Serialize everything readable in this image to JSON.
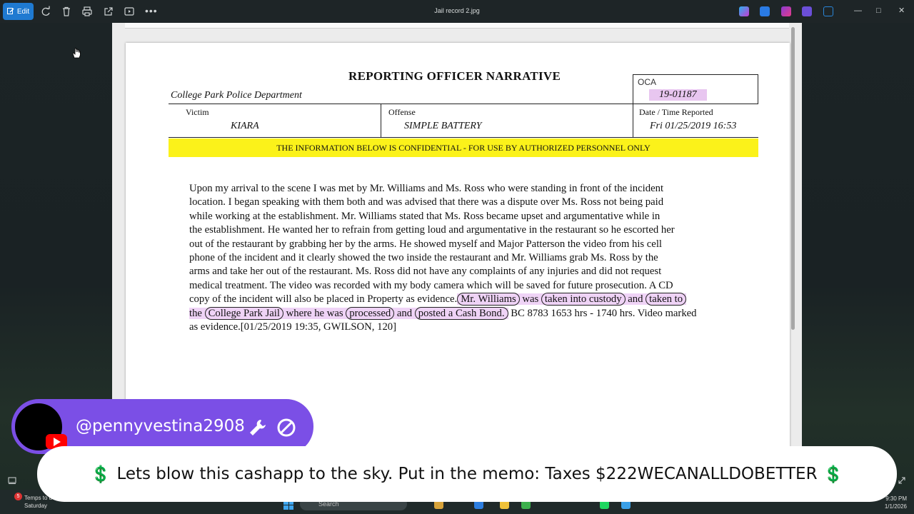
{
  "window": {
    "title": "Jail record 2.jpg",
    "edit_label": "Edit",
    "controls": [
      "minimize-icon",
      "maximize-icon",
      "close-icon"
    ]
  },
  "toolbar": {
    "icons": [
      "rotate-icon",
      "delete-icon",
      "print-icon",
      "share-icon",
      "slideshow-icon",
      "more-icon"
    ]
  },
  "document": {
    "title": "REPORTING OFFICER NARRATIVE",
    "department": "College Park Police Department",
    "oca_label": "OCA",
    "oca_value": "19-01187",
    "victim_label": "Victim",
    "victim_value": "KIARA",
    "offense_label": "Offense",
    "offense_value": "SIMPLE BATTERY",
    "date_label": "Date / Time Reported",
    "date_value": "Fri 01/25/2019 16:53",
    "confidential": "THE INFORMATION BELOW IS CONFIDENTIAL - FOR USE BY AUTHORIZED PERSONNEL ONLY",
    "narrative": [
      "Upon my arrival to the scene I was met by Mr.  Williams and Ms.  Ross who were standing in front of the incident",
      "location.  I began speaking with them both and was advised that there was a dispute over Ms.  Ross not being paid",
      "while working at the establishment.  Mr. Williams stated that Ms.  Ross became upset and argumentative while in",
      "the establishment.  He wanted her to refrain from getting loud and argumentative in the restaurant so he escorted her",
      "out of the restaurant by grabbing her by the arms.  He showed myself and Major Patterson the video from his cell",
      "phone of the incident and it clearly showed the two inside the restaurant and Mr.  Williams grab Ms.  Ross by the",
      "arms and take her out of the restaurant. Ms.  Ross did not have any complaints of any injuries and did not request",
      "medical treatment.  The video was recorded with my body camera which will be saved for future prosecution.  A CD"
    ],
    "line9": {
      "pre": "copy of the incident will also be placed in Property as evidence.",
      "c1": "Mr.  Williams",
      "t1": " was ",
      "c2": "taken into custody",
      "t2": " and ",
      "c3": "taken to"
    },
    "line10": {
      "t0": "the ",
      "c1": "College Park Jail",
      "t1": " where he was ",
      "c2": "processed",
      "t2": " and ",
      "c3": "posted a Cash Bond.",
      "post": " BC 8783 1653 hrs - 1740 hrs. Video marked"
    },
    "line11": "as evidence.[01/25/2019 19:35, GWILSON, 120]"
  },
  "overlay": {
    "handle": "@pennyvestina2908",
    "memo_dollar": "💲",
    "memo_text": "Lets blow this cashapp to the sky. Put in the memo: Taxes $222WECANALLDOBETTER",
    "icons": [
      "avatar",
      "youtube-icon",
      "wrench-icon",
      "no-sign-icon"
    ]
  },
  "taskbar": {
    "weather_badge": "5",
    "weather_text": "Temps to d",
    "weather_day": "Saturday",
    "search_placeholder": "Search",
    "clock_time": "9:30 PM",
    "clock_date": "1/1/2026"
  },
  "colors": {
    "edit_accent": "#1f7ad1",
    "highlight_purple": "#efd3f6",
    "confidential_yellow": "#fbf21a",
    "overlay_purple": "#7b4fe6",
    "dollar_green": "#27a83e"
  }
}
